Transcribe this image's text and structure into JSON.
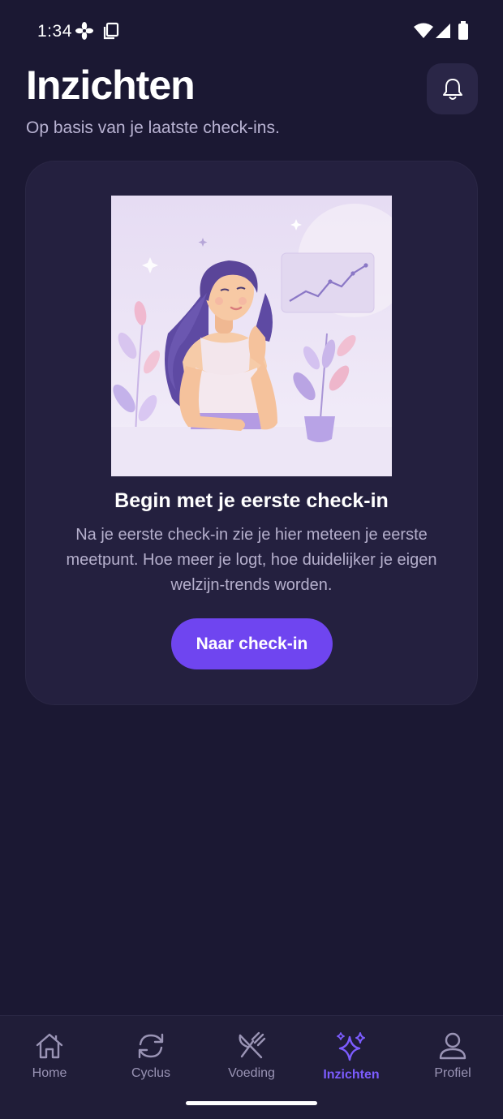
{
  "status_bar": {
    "time": "1:34",
    "icons": [
      "fan-icon",
      "screenshot-icon",
      "wifi-icon",
      "signal-icon",
      "battery-icon"
    ]
  },
  "header": {
    "title": "Inzichten",
    "subtitle": "Op basis van je laatste check-ins.",
    "bell_icon": "bell-icon"
  },
  "empty_state": {
    "illustration": "woman-thinking-with-chart-illustration",
    "title": "Begin met je eerste check-in",
    "body": "Na je eerste check-in zie je hier meteen je eerste meetpunt. Hoe meer je logt, hoe duidelijker je eigen welzijn-trends worden.",
    "button_label": "Naar check-in"
  },
  "bottom_nav": {
    "items": [
      {
        "label": "Home",
        "icon": "home-icon",
        "active": false
      },
      {
        "label": "Cyclus",
        "icon": "cycle-icon",
        "active": false
      },
      {
        "label": "Voeding",
        "icon": "fork-knife-icon",
        "active": false
      },
      {
        "label": "Inzichten",
        "icon": "sparkles-icon",
        "active": true
      },
      {
        "label": "Profiel",
        "icon": "person-icon",
        "active": false
      }
    ]
  },
  "colors": {
    "background": "#1b1833",
    "card": "#24203f",
    "accent": "#6f45f0",
    "active_nav": "#7c5cff",
    "muted_text": "#b5afcc"
  }
}
